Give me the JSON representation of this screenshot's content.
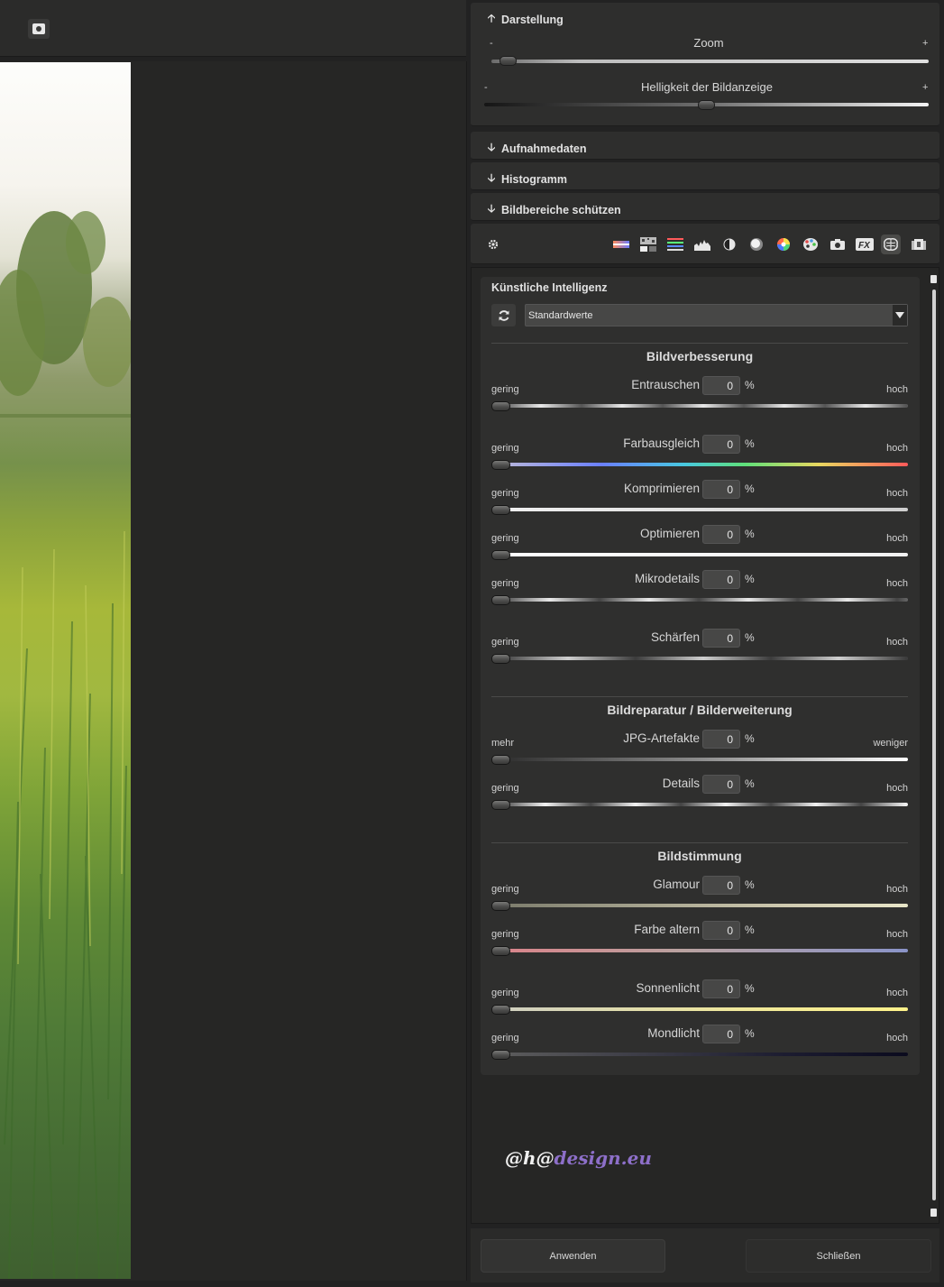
{
  "panel": {
    "display": {
      "title": "Darstellung",
      "zoom_label": "Zoom",
      "zoom_minus": "-",
      "zoom_plus": "+",
      "zoom_value": 0.02,
      "brightness_label": "Helligkeit der Bildanzeige",
      "brightness_minus": "-",
      "brightness_plus": "+",
      "brightness_value": 0.5
    },
    "sections": [
      {
        "title": "Aufnahmedaten"
      },
      {
        "title": "Histogramm"
      },
      {
        "title": "Bildbereiche schützen"
      }
    ],
    "toolbar_icons": [
      "settings-icon",
      "gradient-icon",
      "noise-icon",
      "color-balance-icon",
      "histogram-icon",
      "contrast-icon",
      "tone-icon",
      "color-wheel-icon",
      "palette-icon",
      "camera-icon",
      "fx-icon",
      "ai-brain-icon",
      "frame-icon"
    ]
  },
  "ai": {
    "title": "Künstliche Intelligenz",
    "preset": "Standardwerte",
    "groups": [
      {
        "title": "Bildverbesserung",
        "sliders": [
          {
            "label": "Entrauschen",
            "value": "0",
            "unit": "%",
            "low": "gering",
            "high": "hoch"
          },
          {
            "label": "Farbausgleich",
            "value": "0",
            "unit": "%",
            "low": "gering",
            "high": "hoch"
          },
          {
            "label": "Komprimieren",
            "value": "0",
            "unit": "%",
            "low": "gering",
            "high": "hoch"
          },
          {
            "label": "Optimieren",
            "value": "0",
            "unit": "%",
            "low": "gering",
            "high": "hoch"
          },
          {
            "label": "Mikrodetails",
            "value": "0",
            "unit": "%",
            "low": "gering",
            "high": "hoch"
          },
          {
            "label": "Schärfen",
            "value": "0",
            "unit": "%",
            "low": "gering",
            "high": "hoch"
          }
        ]
      },
      {
        "title": "Bildreparatur / Bilderweiterung",
        "sliders": [
          {
            "label": "JPG-Artefakte",
            "value": "0",
            "unit": "%",
            "low": "mehr",
            "high": "weniger"
          },
          {
            "label": "Details",
            "value": "0",
            "unit": "%",
            "low": "gering",
            "high": "hoch"
          }
        ]
      },
      {
        "title": "Bildstimmung",
        "sliders": [
          {
            "label": "Glamour",
            "value": "0",
            "unit": "%",
            "low": "gering",
            "high": "hoch"
          },
          {
            "label": "Farbe altern",
            "value": "0",
            "unit": "%",
            "low": "gering",
            "high": "hoch"
          },
          {
            "label": "Sonnenlicht",
            "value": "0",
            "unit": "%",
            "low": "gering",
            "high": "hoch"
          },
          {
            "label": "Mondlicht",
            "value": "0",
            "unit": "%",
            "low": "gering",
            "high": "hoch"
          }
        ]
      }
    ]
  },
  "watermark": {
    "part1": "@h@",
    "part2": "design.eu"
  },
  "buttons": {
    "apply": "Anwenden",
    "close": "Schließen"
  }
}
